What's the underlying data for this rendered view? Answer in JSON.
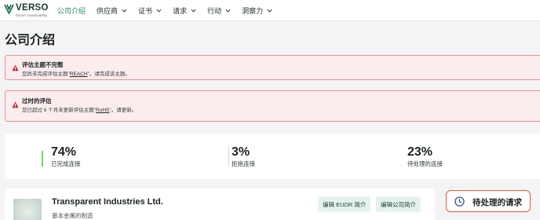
{
  "brand": {
    "name": "VERSO",
    "tagline": "farmer sustainability",
    "color": "#163b33",
    "accent": "#2e8b6f"
  },
  "nav": {
    "items": [
      {
        "label": "公司介绍",
        "active": true,
        "has_menu": false
      },
      {
        "label": "供应商",
        "active": false,
        "has_menu": true
      },
      {
        "label": "证书",
        "active": false,
        "has_menu": true
      },
      {
        "label": "请求",
        "active": false,
        "has_menu": true
      },
      {
        "label": "行动",
        "active": false,
        "has_menu": true
      },
      {
        "label": "洞察力",
        "active": false,
        "has_menu": true
      }
    ]
  },
  "page": {
    "title": "公司介绍"
  },
  "alerts": [
    {
      "icon": "warning-icon",
      "title": "评估主题不完整",
      "body_prefix": "您尚未完成评估主题\"",
      "body_link": "REACH",
      "body_suffix": "\"。请完成该主题。"
    },
    {
      "icon": "warning-icon",
      "title": "过时的评估",
      "body_prefix": "您已超过 6 个月未更新评估主题\"",
      "body_link": "RoHS",
      "body_suffix": "\"。请更新。"
    }
  ],
  "stats": [
    {
      "value": "74%",
      "label": "已完成连接"
    },
    {
      "value": "3%",
      "label": "拒绝连接"
    },
    {
      "value": "23%",
      "label": "待处理的连接"
    }
  ],
  "company": {
    "name": "Transparent Industries Ltd.",
    "subtitle": "基本金属的制造",
    "edit_eudr_label": "编辑 EUDR 简介",
    "edit_profile_label": "编辑公司简介"
  },
  "pending": {
    "label": "待处理的请求",
    "icon": "clock-icon",
    "border_color": "#e8582a"
  },
  "colors": {
    "alert_bg": "#fbecee",
    "alert_border": "#ef8f96",
    "alert_icon": "#c62f3a",
    "button_bg": "#e4f3ef",
    "progress_green": "#7ccf6b"
  }
}
